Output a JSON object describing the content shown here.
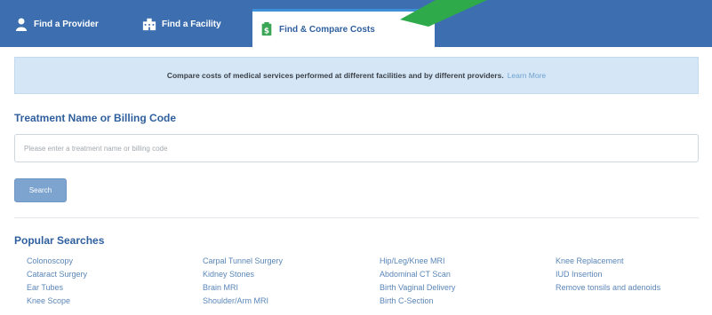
{
  "tabs": [
    {
      "label": "Find a Provider",
      "icon": "person-icon"
    },
    {
      "label": "Find a Facility",
      "icon": "building-icon"
    },
    {
      "label": "Find & Compare Costs",
      "icon": "dollar-document-icon",
      "active": true
    }
  ],
  "colors": {
    "nav": "#3d6fb0",
    "accent": "#2f5f9e",
    "banner": "#d5e7f6",
    "link": "#5a86b8",
    "arrow": "#2eaa4a"
  },
  "banner": {
    "text": "Compare costs of medical services performed at different facilities and by different providers.",
    "link": "Learn More"
  },
  "treatment": {
    "title": "Treatment Name or Billing Code",
    "placeholder": "Please enter a treatment name or billing code",
    "value": ""
  },
  "search_button": "Search",
  "popular": {
    "title": "Popular Searches",
    "columns": [
      [
        "Colonoscopy",
        "Cataract Surgery",
        "Ear Tubes",
        "Knee Scope"
      ],
      [
        "Carpal Tunnel Surgery",
        "Kidney Stones",
        "Brain MRI",
        "Shoulder/Arm MRI"
      ],
      [
        "Hip/Leg/Knee MRI",
        "Abdominal CT Scan",
        "Birth Vaginal Delivery",
        "Birth C-Section"
      ],
      [
        "Knee Replacement",
        "IUD Insertion",
        "Remove tonsils and adenoids"
      ]
    ]
  }
}
